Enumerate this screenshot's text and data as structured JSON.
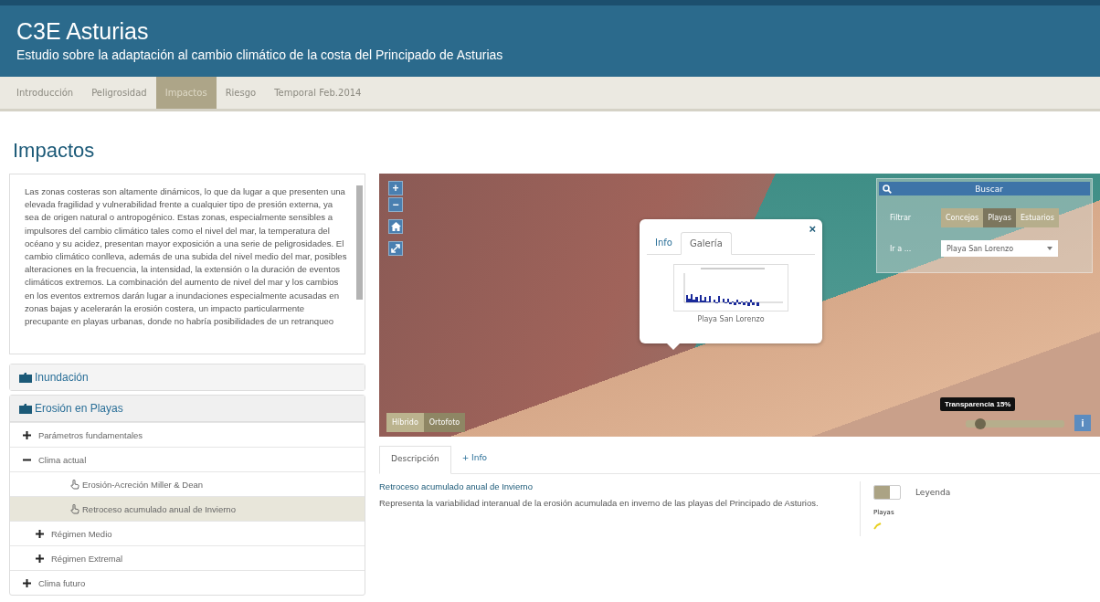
{
  "header": {
    "title": "C3E Asturias",
    "subtitle": "Estudio sobre la adaptación al cambio climático de la costa del Principado de Asturias"
  },
  "nav": [
    {
      "label": "Introducción",
      "selected": false
    },
    {
      "label": "Peligrosidad",
      "selected": false
    },
    {
      "label": "Impactos",
      "selected": true
    },
    {
      "label": "Riesgo",
      "selected": false
    },
    {
      "label": "Temporal Feb.2014",
      "selected": false
    }
  ],
  "page_title": "Impactos",
  "intro_text": "Las zonas costeras son altamente dinámicos, lo que da lugar a que presenten una elevada fragilidad y vulnerabilidad frente a cualquier tipo de presión externa, ya sea de origen natural o antropogénico. Estas zonas, especialmente sensibles a impulsores del cambio climático tales como el nivel del mar, la temperatura del océano y su acidez, presentan mayor exposición a una serie de peligrosidades. El cambio climático conlleva, además de una subida del nivel medio del mar, posibles alteraciones en la frecuencia, la intensidad, la extensión o la duración de eventos climáticos extremos. La combinación del aumento de nivel del mar y los cambios en los eventos extremos darán lugar a inundaciones especialmente acusadas en zonas bajas y acelerarán la erosión costera, un impacto particularmente precupante en playas urbanas, donde no habría posibilidades de un retranqueo",
  "tree": [
    {
      "kind": "group",
      "label": "Inundación",
      "expanded": false
    },
    {
      "kind": "group",
      "label": "Erosión en Playas",
      "expanded": true,
      "children": [
        {
          "kind": "branch",
          "label": "Parámetros fundamentales",
          "expanded": false
        },
        {
          "kind": "branch",
          "label": "Clima actual",
          "expanded": true,
          "children": [
            {
              "kind": "layer",
              "label": "Erosión-Acreción Miller & Dean",
              "selected": false
            },
            {
              "kind": "layer",
              "label": "Retroceso acumulado anual de Invierno",
              "selected": true
            },
            {
              "kind": "branch",
              "label": "Régimen Medio",
              "expanded": false
            },
            {
              "kind": "branch",
              "label": "Régimen Extremal",
              "expanded": false
            }
          ]
        },
        {
          "kind": "branch",
          "label": "Clima futuro",
          "expanded": false
        }
      ]
    }
  ],
  "map": {
    "zoom_in": "+",
    "zoom_out": "−",
    "popup": {
      "tabs": [
        {
          "label": "Info",
          "selected": false
        },
        {
          "label": "Galería",
          "selected": true
        }
      ],
      "close": "×",
      "caption": "Playa San Lorenzo"
    },
    "search": {
      "title": "Buscar",
      "filter_label": "Filtrar",
      "filters": [
        {
          "label": "Concejos",
          "selected": false
        },
        {
          "label": "Playas",
          "selected": true
        },
        {
          "label": "Estuarios",
          "selected": false
        }
      ],
      "goto_label": "Ir a ...",
      "goto_value": "Playa San Lorenzo"
    },
    "base_layers": [
      {
        "label": "Híbrido",
        "selected": false
      },
      {
        "label": "Ortofoto",
        "selected": true
      }
    ],
    "transparency": {
      "tooltip": "Transparencia 15%",
      "level": 0.15
    },
    "info_button": "i"
  },
  "detail_tabs": [
    {
      "label": "Descripción",
      "selected": true
    },
    {
      "label": "+ Info",
      "selected": false
    }
  ],
  "description": {
    "title": "Retroceso acumulado anual de Invierno",
    "text": "Representa la variabilidad interanual de la erosión acumulada en inverno de las playas del Principado de Asturios."
  },
  "legend": {
    "on": false,
    "label": "Leyenda",
    "layer": "Playas"
  }
}
